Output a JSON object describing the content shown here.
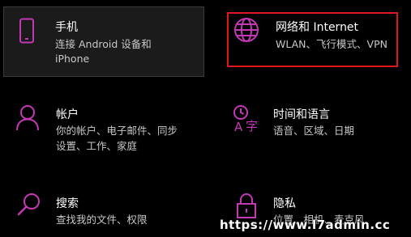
{
  "colors": {
    "background": "#000000",
    "accent": "#c239b3",
    "selection_border": "#e0161b",
    "title_text": "#ffffff",
    "desc_text": "#c8c8c8"
  },
  "tiles": {
    "phone": {
      "icon": "phone-icon",
      "title": "手机",
      "desc_line1": "连接 Android 设备和",
      "desc_line2": "iPhone"
    },
    "network": {
      "icon": "globe-icon",
      "title": "网络和 Internet",
      "desc_line1": "WLAN、飞行模式、VPN"
    },
    "accounts": {
      "icon": "person-icon",
      "title": "帐户",
      "desc_line1": "你的帐户、电子邮件、同步",
      "desc_line2": "设置、工作、家庭"
    },
    "time_language": {
      "icon": "time-language-icon",
      "title": "时间和语言",
      "desc_line1": "语音、区域、日期"
    },
    "search": {
      "icon": "search-icon",
      "title": "搜索",
      "desc_line1": "查找我的文件、权限"
    },
    "privacy": {
      "icon": "lock-icon",
      "title": "隐私",
      "desc_line1": "位置、相机、麦克风"
    }
  },
  "watermark": "https://www.l7admin.cc"
}
